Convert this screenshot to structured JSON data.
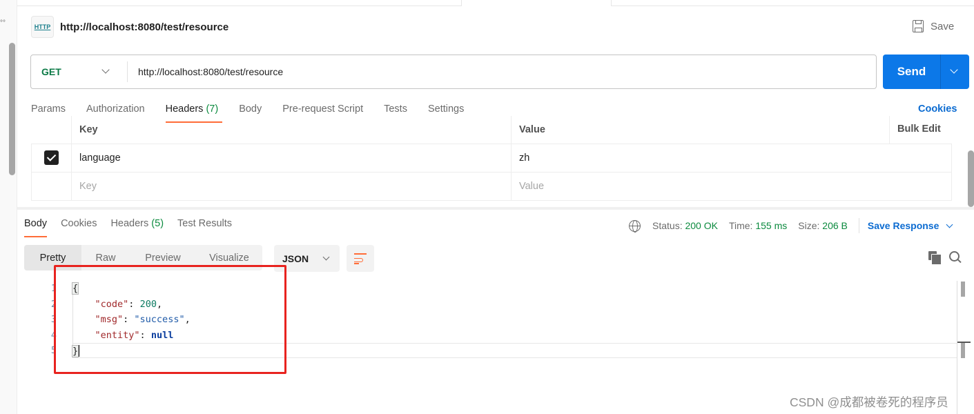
{
  "request": {
    "title": "http://localhost:8080/test/resource",
    "icon": "http-icon",
    "icon_text": "HTTP",
    "save_label": "Save",
    "method": "GET",
    "url": "http://localhost:8080/test/resource",
    "send_label": "Send"
  },
  "request_tabs": [
    {
      "label": "Params"
    },
    {
      "label": "Authorization"
    },
    {
      "label": "Headers",
      "count": "(7)",
      "active": true
    },
    {
      "label": "Body"
    },
    {
      "label": "Pre-request Script"
    },
    {
      "label": "Tests"
    },
    {
      "label": "Settings"
    }
  ],
  "cookies_link": "Cookies",
  "headers_table": {
    "columns": {
      "key": "Key",
      "value": "Value",
      "bulk_edit": "Bulk Edit"
    },
    "rows": [
      {
        "checked": true,
        "key": "language",
        "value": "zh"
      }
    ],
    "placeholder": {
      "key": "Key",
      "value": "Value"
    }
  },
  "response_tabs": [
    {
      "label": "Body",
      "active": true
    },
    {
      "label": "Cookies"
    },
    {
      "label": "Headers",
      "count": "(5)"
    },
    {
      "label": "Test Results"
    }
  ],
  "response_meta": {
    "status_label": "Status:",
    "status_value": "200 OK",
    "time_label": "Time:",
    "time_value": "155 ms",
    "size_label": "Size:",
    "size_value": "206 B",
    "save_response": "Save Response"
  },
  "view_modes": [
    "Pretty",
    "Raw",
    "Preview",
    "Visualize"
  ],
  "active_view": "Pretty",
  "format": "JSON",
  "response_body": {
    "line_numbers": [
      "1",
      "2",
      "3",
      "4",
      "5"
    ],
    "open_brace": "{",
    "close_brace": "}",
    "fields": [
      {
        "key": "\"code\"",
        "value": "200",
        "type": "number",
        "trail": ","
      },
      {
        "key": "\"msg\"",
        "value": "\"success\"",
        "type": "string",
        "trail": ","
      },
      {
        "key": "\"entity\"",
        "value": "null",
        "type": "null",
        "trail": ""
      }
    ]
  },
  "watermark": "CSDN @成都被卷死的程序员",
  "colors": {
    "accent_orange": "#ff6c37",
    "send_blue": "#0c78e8",
    "link_blue": "#0b6bd1",
    "success_green": "#0b8a3e",
    "annotation_red": "#e8231f"
  }
}
